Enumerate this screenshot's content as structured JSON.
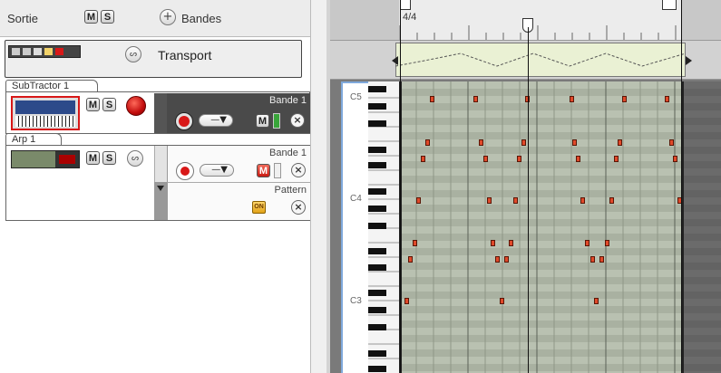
{
  "header": {
    "sortie": "Sortie",
    "m": "M",
    "s": "S",
    "bandes": "Bandes",
    "plus": "+"
  },
  "transport": {
    "label": "Transport",
    "zoom_in": "⊕",
    "zoom_out": "⊖"
  },
  "tracks": [
    {
      "name": "SubTractor 1",
      "lane_label": "Bande 1",
      "m": "M",
      "s": "S",
      "dropdown": "—▼"
    },
    {
      "name": "Arp 1",
      "lane_label": "Bande 1",
      "m": "M",
      "s": "S",
      "dropdown": "—▼",
      "pattern_label": "Pattern",
      "pattern_on": "ON"
    }
  ],
  "ruler": {
    "time_sig": "4/4"
  },
  "piano": {
    "c5": "C5",
    "c4": "C4",
    "c3": "C3"
  },
  "colors": {
    "note": "#e0492a",
    "grid_bg": "#b8c0b0",
    "dark_bg": "#6a6a6a",
    "accent_red": "#d81818"
  },
  "notes": [
    {
      "col": 474,
      "row": 106
    },
    {
      "col": 522,
      "row": 106
    },
    {
      "col": 579,
      "row": 106
    },
    {
      "col": 628,
      "row": 106
    },
    {
      "col": 686,
      "row": 106
    },
    {
      "col": 733,
      "row": 106
    },
    {
      "col": 469,
      "row": 154
    },
    {
      "col": 528,
      "row": 154
    },
    {
      "col": 575,
      "row": 154
    },
    {
      "col": 631,
      "row": 154
    },
    {
      "col": 681,
      "row": 154
    },
    {
      "col": 738,
      "row": 154
    },
    {
      "col": 464,
      "row": 172
    },
    {
      "col": 533,
      "row": 172
    },
    {
      "col": 570,
      "row": 172
    },
    {
      "col": 635,
      "row": 172
    },
    {
      "col": 677,
      "row": 172
    },
    {
      "col": 742,
      "row": 172
    },
    {
      "col": 459,
      "row": 218
    },
    {
      "col": 537,
      "row": 218
    },
    {
      "col": 566,
      "row": 218
    },
    {
      "col": 640,
      "row": 218
    },
    {
      "col": 672,
      "row": 218
    },
    {
      "col": 747,
      "row": 218
    },
    {
      "col": 455,
      "row": 265
    },
    {
      "col": 541,
      "row": 265
    },
    {
      "col": 561,
      "row": 265
    },
    {
      "col": 645,
      "row": 265
    },
    {
      "col": 667,
      "row": 265
    },
    {
      "col": 450,
      "row": 283
    },
    {
      "col": 546,
      "row": 283
    },
    {
      "col": 556,
      "row": 283
    },
    {
      "col": 651,
      "row": 283
    },
    {
      "col": 661,
      "row": 283
    },
    {
      "col": 446,
      "row": 329
    },
    {
      "col": 551,
      "row": 329
    },
    {
      "col": 655,
      "row": 329
    }
  ]
}
